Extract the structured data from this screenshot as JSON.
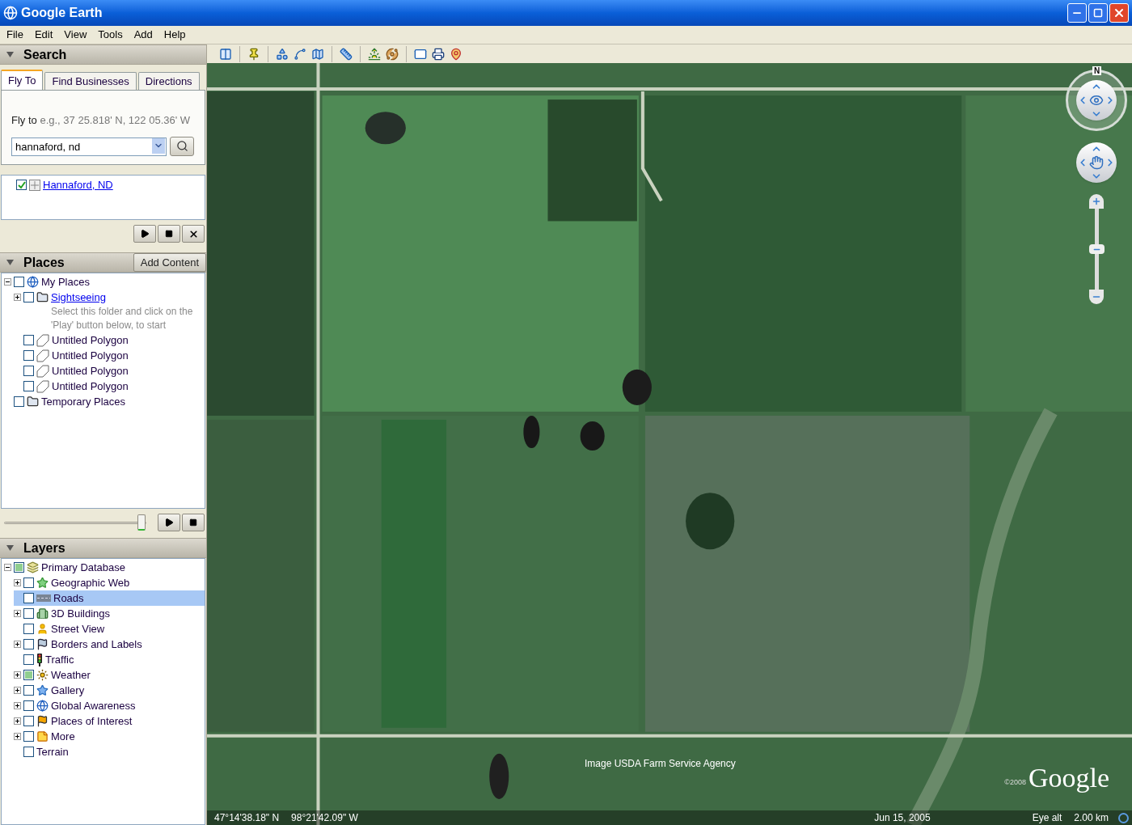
{
  "window": {
    "title": "Google Earth"
  },
  "menu": [
    "File",
    "Edit",
    "View",
    "Tools",
    "Add",
    "Help"
  ],
  "search": {
    "title": "Search",
    "tabs": [
      {
        "label": "Fly To",
        "selected": true
      },
      {
        "label": "Find Businesses",
        "selected": false
      },
      {
        "label": "Directions",
        "selected": false
      }
    ],
    "fly_to_label": "Fly to",
    "fly_to_hint": "e.g., 37 25.818' N, 122 05.36' W",
    "query": "hannaford, nd",
    "results": [
      {
        "label": "Hannaford, ND",
        "kind": "place",
        "link": true,
        "checked": true
      }
    ]
  },
  "places": {
    "title": "Places",
    "add_content": "Add Content",
    "tour_slider": {
      "level": 0.97
    },
    "items": [
      {
        "label": "My Places",
        "kind": "globe",
        "checked": false,
        "expanded": true,
        "children": [
          {
            "label": "Sightseeing",
            "kind": "folder",
            "link": true,
            "checked": false,
            "expanded": false,
            "description": "Select this folder and click on the 'Play' button below, to start"
          },
          {
            "label": "Untitled Polygon",
            "kind": "polygon",
            "checked": false
          },
          {
            "label": "Untitled Polygon",
            "kind": "polygon",
            "checked": false
          },
          {
            "label": "Untitled Polygon",
            "kind": "polygon",
            "checked": false
          },
          {
            "label": "Untitled Polygon",
            "kind": "polygon",
            "checked": false
          }
        ]
      },
      {
        "label": "Temporary Places",
        "kind": "folder",
        "checked": false
      }
    ]
  },
  "layers": {
    "title": "Layers",
    "items": [
      {
        "label": "Primary Database",
        "kind": "layers",
        "checked": false,
        "partial": true,
        "selected": false,
        "expanded": true,
        "children": [
          {
            "label": "Geographic Web",
            "kind": "star",
            "checked": false,
            "partial": false,
            "selected": false,
            "expanded": false
          },
          {
            "label": "Roads",
            "kind": "road",
            "checked": false,
            "partial": false,
            "selected": true
          },
          {
            "label": "3D Buildings",
            "kind": "building",
            "checked": false,
            "partial": false,
            "selected": false,
            "expanded": false
          },
          {
            "label": "Street View",
            "kind": "person",
            "checked": false,
            "partial": false,
            "selected": false
          },
          {
            "label": "Borders and Labels",
            "kind": "flags",
            "checked": false,
            "partial": false,
            "selected": false,
            "expanded": false
          },
          {
            "label": "Traffic",
            "kind": "traffic",
            "checked": false,
            "partial": false,
            "selected": false
          },
          {
            "label": "Weather",
            "kind": "sun",
            "checked": false,
            "partial": true,
            "selected": false,
            "expanded": false
          },
          {
            "label": "Gallery",
            "kind": "bluestar",
            "checked": false,
            "partial": false,
            "selected": false,
            "expanded": false
          },
          {
            "label": "Global Awareness",
            "kind": "globe",
            "checked": false,
            "partial": false,
            "selected": false,
            "expanded": false
          },
          {
            "label": "Places of Interest",
            "kind": "flag",
            "checked": false,
            "partial": false,
            "selected": false,
            "expanded": false
          },
          {
            "label": "More",
            "kind": "note",
            "checked": false,
            "partial": false,
            "selected": false,
            "expanded": false
          },
          {
            "label": "Terrain",
            "kind": "none",
            "checked": false,
            "partial": false,
            "selected": false
          }
        ]
      }
    ]
  },
  "map": {
    "compass_label": "N",
    "zoom_slider": {
      "level": 0.5
    },
    "attribution": "Image USDA Farm Service Agency",
    "copyright": "©2008",
    "logo": "Google",
    "latitude": "47°14'38.18\" N",
    "longitude": "98°21'42.09\" W",
    "date": "Jun 15, 2005",
    "eye_alt_label": "Eye alt",
    "eye_alt": "2.00 km"
  }
}
